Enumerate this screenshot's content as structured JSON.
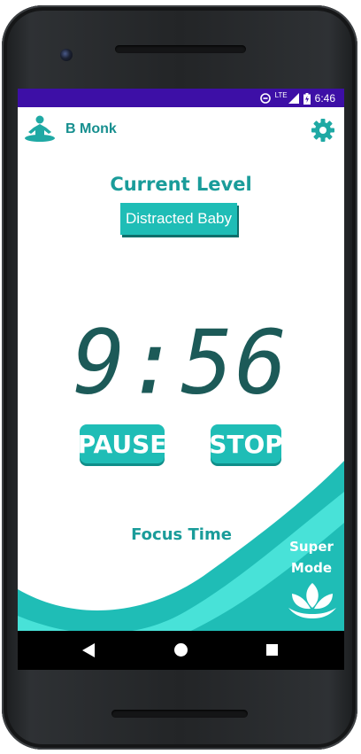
{
  "status_bar": {
    "network": "LTE",
    "time": "6:46"
  },
  "app_bar": {
    "title": "B Monk",
    "logo_icon": "meditation-icon",
    "settings_icon": "gear-icon"
  },
  "level": {
    "heading": "Current Level",
    "value": "Distracted Baby"
  },
  "timer": {
    "display": "9:56"
  },
  "controls": {
    "pause_label": "PAUSE",
    "stop_label": "STOP"
  },
  "focus": {
    "label": "Focus Time"
  },
  "super_mode": {
    "line1": "Super",
    "line2": "Mode",
    "icon": "lotus-icon"
  },
  "nav": {
    "back_icon": "back-icon",
    "home_icon": "home-icon",
    "recents_icon": "recents-icon"
  },
  "colors": {
    "status_bar": "#3d0fa6",
    "accent": "#1fbdb6",
    "title_teal": "#1a9c9a",
    "timer_digits": "#1c5a58"
  }
}
